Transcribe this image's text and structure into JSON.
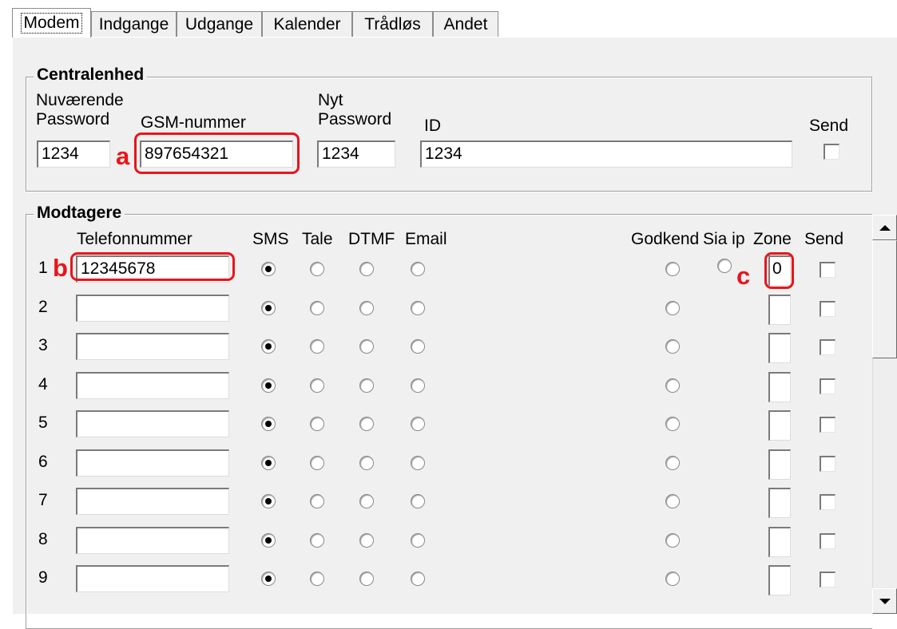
{
  "tabs": [
    "Modem",
    "Indgange",
    "Udgange",
    "Kalender",
    "Trådløs",
    "Andet"
  ],
  "central": {
    "legend": "Centralenhed",
    "current_password_label_1": "Nuværende",
    "current_password_label_2": "Password",
    "gsm_label": "GSM-nummer",
    "new_password_label_1": "Nyt",
    "new_password_label_2": "Password",
    "id_label": "ID",
    "send_label": "Send",
    "current_password": "1234",
    "gsm_number": "897654321",
    "new_password": "1234",
    "id": "1234",
    "send_checked": false
  },
  "receivers": {
    "legend": "Modtagere",
    "headers": {
      "phone": "Telefonnummer",
      "sms": "SMS",
      "tale": "Tale",
      "dtmf": "DTMF",
      "email": "Email",
      "godkend": "Godkend",
      "sia_ip": "Sia ip",
      "zone": "Zone",
      "send": "Send"
    },
    "rows": [
      {
        "num": "1",
        "phone": "12345678",
        "mode": "SMS",
        "zone": "0"
      },
      {
        "num": "2",
        "phone": "",
        "mode": "SMS",
        "zone": ""
      },
      {
        "num": "3",
        "phone": "",
        "mode": "SMS",
        "zone": ""
      },
      {
        "num": "4",
        "phone": "",
        "mode": "SMS",
        "zone": ""
      },
      {
        "num": "5",
        "phone": "",
        "mode": "SMS",
        "zone": ""
      },
      {
        "num": "6",
        "phone": "",
        "mode": "SMS",
        "zone": ""
      },
      {
        "num": "7",
        "phone": "",
        "mode": "SMS",
        "zone": ""
      },
      {
        "num": "8",
        "phone": "",
        "mode": "SMS",
        "zone": ""
      },
      {
        "num": "9",
        "phone": "",
        "mode": "SMS",
        "zone": ""
      }
    ]
  },
  "annotations": {
    "a": "a",
    "b": "b",
    "c": "c"
  },
  "colors": {
    "highlight": "#e8151b",
    "panel": "#f0f0f0"
  }
}
